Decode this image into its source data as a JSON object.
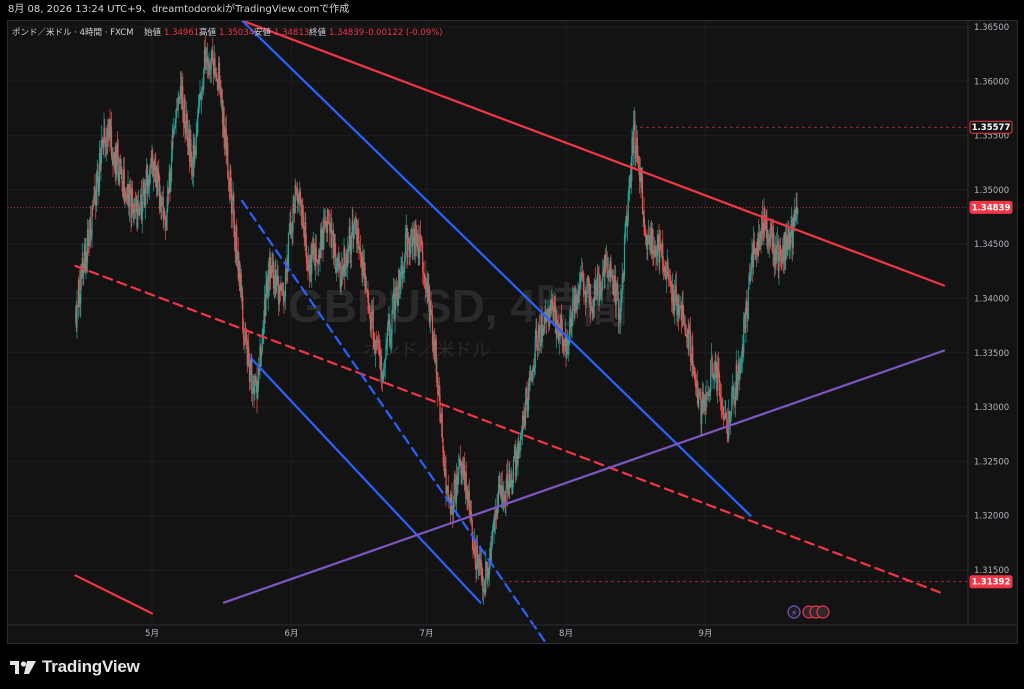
{
  "header": {
    "timestamp_line": "8月 08, 2026 13:24 UTC+9、dreamtodorokiがTradingView.comで作成"
  },
  "legend": {
    "instrument": "ポンド／米ドル · 4時間 · FXCM",
    "open_label": "始値",
    "open": "1.34961",
    "high_label": "高値",
    "high": "1.35034",
    "low_label": "安値",
    "low": "1.34813",
    "close_label": "終値",
    "close": "1.34839",
    "change": "-0.00122 (-0.09%)"
  },
  "watermark": {
    "symbol": "GBPUSD, 4時間",
    "name": "ポンド／米ドル"
  },
  "colors": {
    "background": "#131313",
    "up": "#26a69a",
    "down": "#ef5350",
    "red_line": "#f23645",
    "blue_line": "#2962ff",
    "purple_line": "#7e57c2",
    "grid": "#1e1e1e"
  },
  "chart_data": {
    "type": "candlestick",
    "symbol": "GBPUSD",
    "timeframe": "4時間",
    "y_axis_labels": [
      "1.36500",
      "1.36000",
      "1.35500",
      "1.35000",
      "1.34500",
      "1.34000",
      "1.33500",
      "1.33000",
      "1.32500",
      "1.32000",
      "1.31500"
    ],
    "ylim": [
      1.312,
      1.366
    ],
    "x_axis_labels": [
      "5月",
      "6月",
      "7月",
      "8月",
      "9月"
    ],
    "price_markers": [
      {
        "label": "1.35577",
        "value": 1.35577,
        "style": "outline"
      },
      {
        "label": "1.34839",
        "value": 1.34839,
        "style": "filled"
      },
      {
        "label": "1.31392",
        "value": 1.31392,
        "style": "filled"
      }
    ],
    "approx_price_path": [
      {
        "date": "2026-04-14",
        "price": 1.3385
      },
      {
        "date": "2026-04-17",
        "price": 1.346
      },
      {
        "date": "2026-04-21",
        "price": 1.356
      },
      {
        "date": "2026-04-25",
        "price": 1.35
      },
      {
        "date": "2026-04-28",
        "price": 1.3475
      },
      {
        "date": "2026-05-01",
        "price": 1.353
      },
      {
        "date": "2026-05-04",
        "price": 1.347
      },
      {
        "date": "2026-05-07",
        "price": 1.36
      },
      {
        "date": "2026-05-10",
        "price": 1.352
      },
      {
        "date": "2026-05-13",
        "price": 1.363
      },
      {
        "date": "2026-05-16",
        "price": 1.36
      },
      {
        "date": "2026-05-19",
        "price": 1.348
      },
      {
        "date": "2026-05-22",
        "price": 1.335
      },
      {
        "date": "2026-05-24",
        "price": 1.331
      },
      {
        "date": "2026-05-27",
        "price": 1.343
      },
      {
        "date": "2026-05-30",
        "price": 1.34
      },
      {
        "date": "2026-06-02",
        "price": 1.3505
      },
      {
        "date": "2026-06-05",
        "price": 1.343
      },
      {
        "date": "2026-06-09",
        "price": 1.347
      },
      {
        "date": "2026-06-12",
        "price": 1.342
      },
      {
        "date": "2026-06-15",
        "price": 1.347
      },
      {
        "date": "2026-06-18",
        "price": 1.34
      },
      {
        "date": "2026-06-21",
        "price": 1.333
      },
      {
        "date": "2026-06-24",
        "price": 1.34
      },
      {
        "date": "2026-06-27",
        "price": 1.346
      },
      {
        "date": "2026-06-30",
        "price": 1.344
      },
      {
        "date": "2026-07-03",
        "price": 1.335
      },
      {
        "date": "2026-07-06",
        "price": 1.32
      },
      {
        "date": "2026-07-09",
        "price": 1.325
      },
      {
        "date": "2026-07-12",
        "price": 1.316
      },
      {
        "date": "2026-07-14",
        "price": 1.3139
      },
      {
        "date": "2026-07-17",
        "price": 1.322
      },
      {
        "date": "2026-07-20",
        "price": 1.323
      },
      {
        "date": "2026-07-23",
        "price": 1.33
      },
      {
        "date": "2026-07-26",
        "price": 1.337
      },
      {
        "date": "2026-07-29",
        "price": 1.339
      },
      {
        "date": "2026-08-01",
        "price": 1.336
      },
      {
        "date": "2026-08-04",
        "price": 1.342
      },
      {
        "date": "2026-08-07",
        "price": 1.34
      },
      {
        "date": "2026-08-10",
        "price": 1.343
      },
      {
        "date": "2026-08-13",
        "price": 1.339
      },
      {
        "date": "2026-08-16",
        "price": 1.3555
      },
      {
        "date": "2026-08-19",
        "price": 1.346
      },
      {
        "date": "2026-08-22",
        "price": 1.344
      },
      {
        "date": "2026-08-25",
        "price": 1.34
      },
      {
        "date": "2026-08-28",
        "price": 1.337
      },
      {
        "date": "2026-08-31",
        "price": 1.33
      },
      {
        "date": "2026-09-03",
        "price": 1.334
      },
      {
        "date": "2026-09-06",
        "price": 1.328
      },
      {
        "date": "2026-09-09",
        "price": 1.335
      },
      {
        "date": "2026-09-12",
        "price": 1.345
      },
      {
        "date": "2026-09-14",
        "price": 1.347
      },
      {
        "date": "2026-09-17",
        "price": 1.344
      },
      {
        "date": "2026-09-20",
        "price": 1.346
      },
      {
        "date": "2026-09-23",
        "price": 1.3484
      }
    ],
    "trendlines": [
      {
        "name": "red-resistance",
        "color": "#f23645",
        "style": "solid",
        "from": {
          "date": "2026-05-21",
          "price": 1.3656
        },
        "to": {
          "date": "2026-10-24",
          "price": 1.3412
        }
      },
      {
        "name": "red-lower-left",
        "color": "#f23645",
        "style": "solid",
        "from": {
          "date": "2026-04-14",
          "price": 1.3145
        },
        "to": {
          "date": "2026-05-01",
          "price": 1.311
        }
      },
      {
        "name": "red-dashed",
        "color": "#f23645",
        "style": "dashed",
        "from": {
          "date": "2026-04-14",
          "price": 1.343
        },
        "to": {
          "date": "2026-10-24",
          "price": 1.3128
        }
      },
      {
        "name": "blue-upper",
        "color": "#2962ff",
        "style": "solid",
        "from": {
          "date": "2026-05-21",
          "price": 1.3656
        },
        "to": {
          "date": "2026-09-11",
          "price": 1.32
        }
      },
      {
        "name": "blue-dashed",
        "color": "#2962ff",
        "style": "dashed",
        "from": {
          "date": "2026-05-21",
          "price": 1.349
        },
        "to": {
          "date": "2026-07-28",
          "price": 1.308
        }
      },
      {
        "name": "blue-lower",
        "color": "#2962ff",
        "style": "solid",
        "from": {
          "date": "2026-05-23",
          "price": 1.3345
        },
        "to": {
          "date": "2026-07-13",
          "price": 1.312
        }
      },
      {
        "name": "purple-support",
        "color": "#7e57c2",
        "style": "solid",
        "from": {
          "date": "2026-05-17",
          "price": 1.312
        },
        "to": {
          "date": "2026-10-24",
          "price": 1.3352
        }
      }
    ],
    "horizontal_levels": [
      {
        "value": 1.35577,
        "style": "dashed",
        "color": "#f23645"
      },
      {
        "value": 1.34839,
        "style": "dotted",
        "color": "#f23645"
      },
      {
        "value": 1.31392,
        "style": "dashed",
        "color": "#f23645"
      }
    ]
  },
  "footer": {
    "brand": "TradingView"
  }
}
